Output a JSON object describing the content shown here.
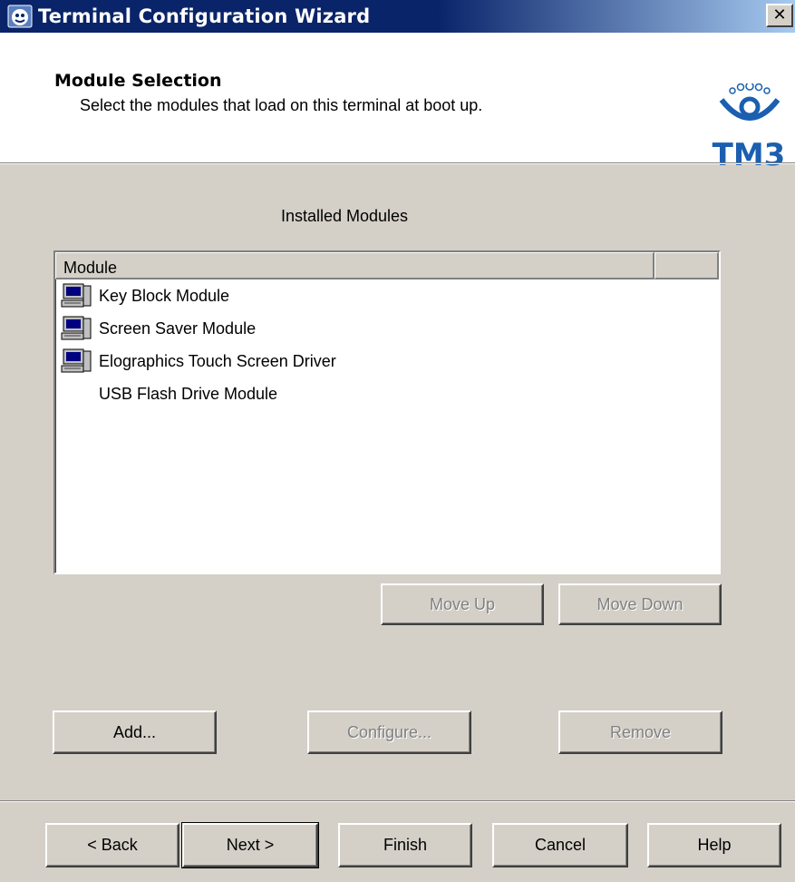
{
  "window": {
    "title": "Terminal Configuration Wizard",
    "close_label": "✕"
  },
  "header": {
    "title": "Module Selection",
    "subtitle": "Select the modules that load on this terminal at boot up.",
    "logo_text": "TM3"
  },
  "modules": {
    "section_label": "Installed Modules",
    "column_header": "Module",
    "rows": [
      {
        "label": "Key Block Module",
        "icon": "computer-icon"
      },
      {
        "label": "Screen Saver Module",
        "icon": "computer-icon"
      },
      {
        "label": "Elographics Touch Screen Driver",
        "icon": "computer-icon"
      },
      {
        "label": "USB Flash Drive Module",
        "icon": "none"
      }
    ],
    "move_up_label": "Move Up",
    "move_down_label": "Move Down",
    "add_label": "Add...",
    "configure_label": "Configure...",
    "remove_label": "Remove"
  },
  "footer": {
    "back_label": "< Back",
    "next_label": "Next >",
    "finish_label": "Finish",
    "cancel_label": "Cancel",
    "help_label": "Help"
  },
  "colors": {
    "title_bar": "#0a246a",
    "dialog_face": "#d4d0c8",
    "disabled_text": "#808080"
  }
}
